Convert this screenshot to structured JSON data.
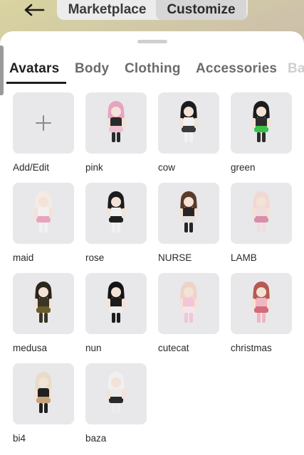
{
  "header": {
    "tabs": [
      {
        "label": "Marketplace",
        "active": false
      },
      {
        "label": "Customize",
        "active": true
      }
    ]
  },
  "categories": [
    {
      "label": "Avatars",
      "active": true
    },
    {
      "label": "Body",
      "active": false
    },
    {
      "label": "Clothing",
      "active": false
    },
    {
      "label": "Accessories",
      "active": false
    },
    {
      "label": "Ba",
      "active": false
    }
  ],
  "avatars": [
    {
      "label": "Add/Edit",
      "icon": "plus-icon"
    },
    {
      "label": "pink",
      "hair": "#e7a4c2",
      "body": "#2a2a2a",
      "accent": "#f0c0d4"
    },
    {
      "label": "cow",
      "hair": "#1b1b1b",
      "body": "#f2f2f2",
      "accent": "#3a3a3a"
    },
    {
      "label": "green",
      "hair": "#1c1c1c",
      "body": "#2d2d2d",
      "accent": "#3cc24a"
    },
    {
      "label": "maid",
      "hair": "#f4ece4",
      "body": "#f4f0f0",
      "accent": "#e8a4bd"
    },
    {
      "label": "rose",
      "hair": "#1c1c1c",
      "body": "#f1f1f1",
      "accent": "#202020"
    },
    {
      "label": "NURSE",
      "hair": "#5a3a2a",
      "body": "#2a2424",
      "accent": "#e6e1dc"
    },
    {
      "label": "LAMB",
      "hair": "#f2d8d4",
      "body": "#f0dede",
      "accent": "#d98ea8"
    },
    {
      "label": "medusa",
      "hair": "#2a2618",
      "body": "#3a3626",
      "accent": "#6b5a2a"
    },
    {
      "label": "nun",
      "hair": "#141414",
      "body": "#1d1d1d",
      "accent": "#ededed"
    },
    {
      "label": "cutecat",
      "hair": "#efd3c8",
      "body": "#f2c6d4",
      "accent": "#f6e4ea"
    },
    {
      "label": "christmas",
      "hair": "#b75a50",
      "body": "#f0b6c2",
      "accent": "#d46a7a"
    },
    {
      "label": "bi4",
      "hair": "#e8dcc8",
      "body": "#202020",
      "accent": "#c7a27a"
    },
    {
      "label": "baza",
      "hair": "#f0f0f0",
      "body": "#ececec",
      "accent": "#2a2a2a"
    }
  ],
  "colors": {
    "sheet_bg": "#ffffff",
    "thumb_bg": "#e8e8eb",
    "active_text": "#1f1f1f",
    "inactive_text": "#6b6b6b"
  }
}
